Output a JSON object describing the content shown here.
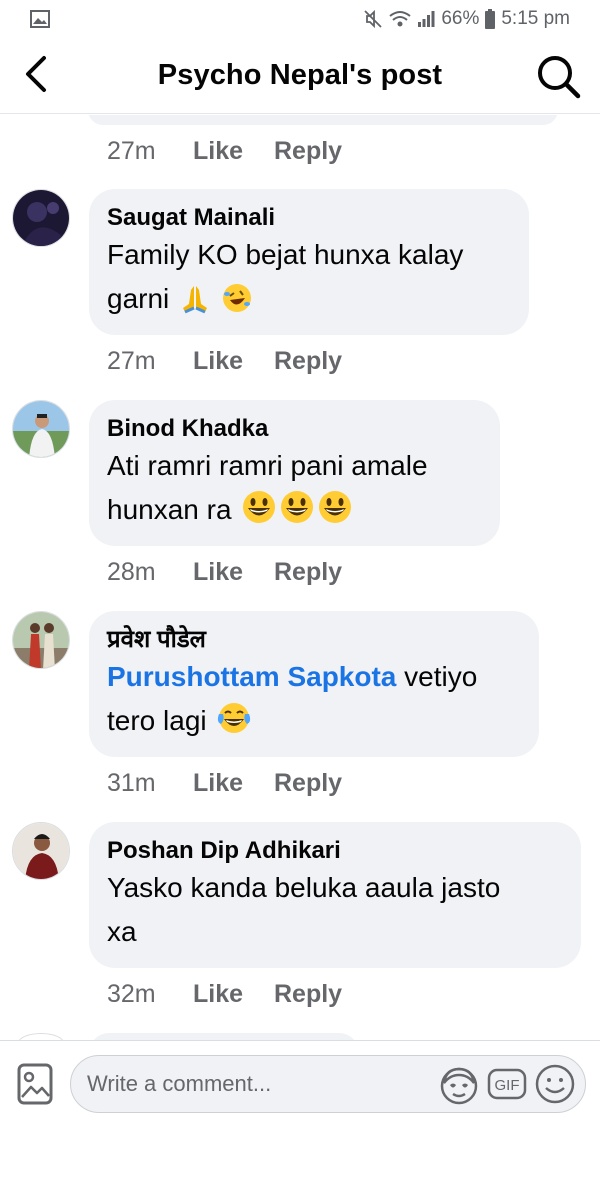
{
  "status_bar": {
    "battery": "66%",
    "time": "5:15 pm"
  },
  "header": {
    "title": "Psycho Nepal's post"
  },
  "previous_comment": {
    "time": "27m",
    "like": "Like",
    "reply": "Reply"
  },
  "comments": [
    {
      "author": "Saugat Mainali",
      "line1": "Family KO bejat hunxa kalay",
      "line2": "garni",
      "emojis": [
        "folded-hands",
        "rolling-laughing"
      ],
      "time": "27m",
      "like": "Like",
      "reply": "Reply"
    },
    {
      "author": "Binod Khadka",
      "line1": "Ati ramri ramri pani amale",
      "line2": "hunxan ra",
      "emojis": [
        "grinning",
        "grinning",
        "grinning"
      ],
      "time": "28m",
      "like": "Like",
      "reply": "Reply"
    },
    {
      "author": "प्रवेश पौडेल",
      "mention": "Purushottam Sapkota",
      "line1_rest": " vetiyo",
      "line2": "tero lagi",
      "emojis": [
        "tears-of-joy"
      ],
      "time": "31m",
      "like": "Like",
      "reply": "Reply"
    },
    {
      "author": "Poshan Dip Adhikari",
      "line1": "Yasko kanda beluka aaula jasto",
      "line2": "xa",
      "time": "32m",
      "like": "Like",
      "reply": "Reply"
    }
  ],
  "composer": {
    "placeholder": "Write a comment...",
    "gif_label": "GIF"
  },
  "colors": {
    "bubble": "#f0f2f5",
    "mention": "#1b74e4",
    "meta": "#65676b",
    "text": "#050505"
  }
}
